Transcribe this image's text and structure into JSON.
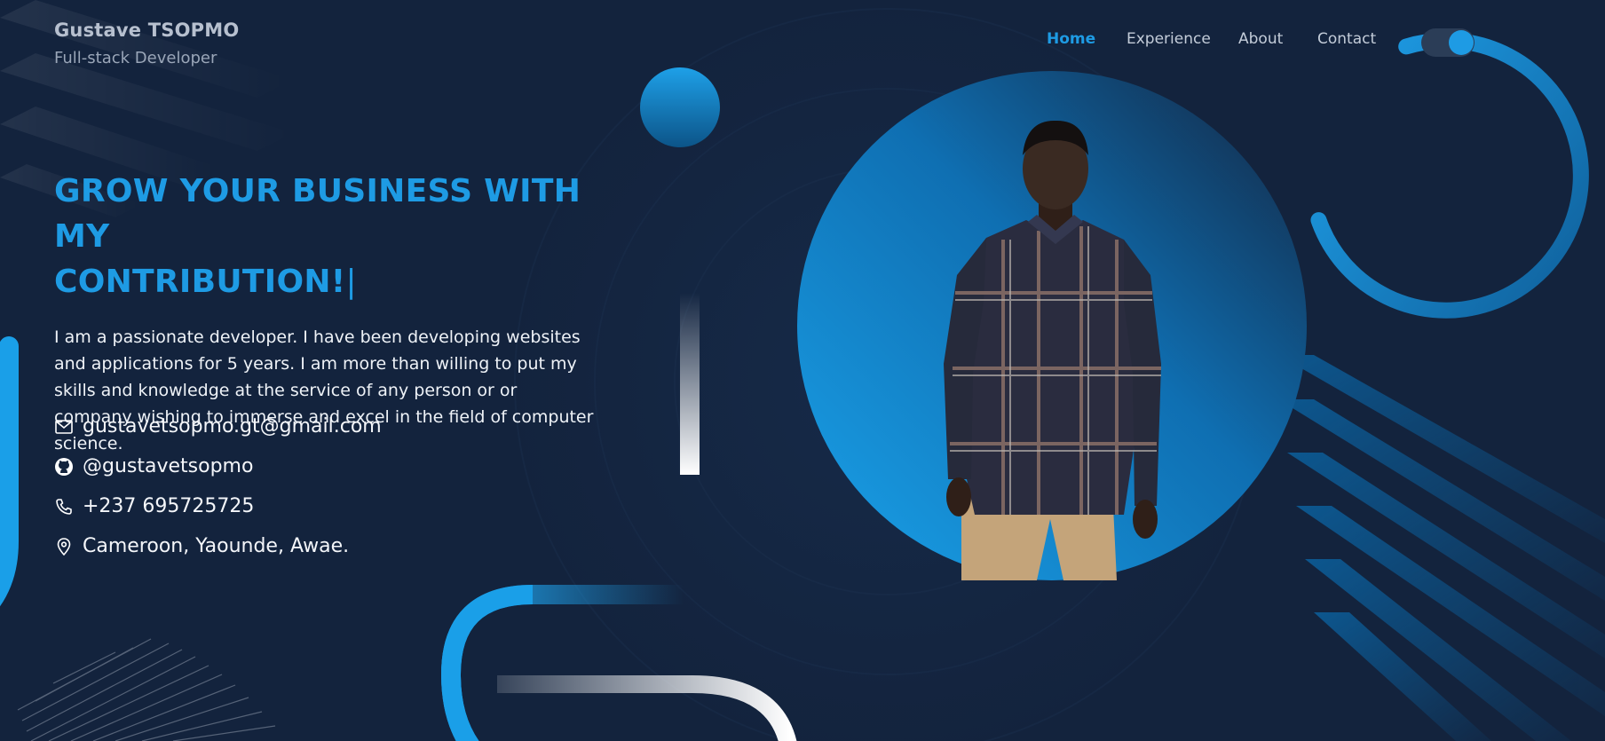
{
  "brand": {
    "name": "Gustave TSOPMO",
    "role": "Full-stack Developer"
  },
  "nav": {
    "items": [
      {
        "label": "Home",
        "active": true
      },
      {
        "label": "Experience",
        "active": false
      },
      {
        "label": "About",
        "active": false
      },
      {
        "label": "Contact",
        "active": false
      }
    ],
    "theme_toggle": {
      "icon": "moon-icon",
      "state": "dark"
    }
  },
  "hero": {
    "headline_line1": "GROW YOUR BUSINESS WITH MY",
    "headline_line2": "CONTRIBUTION!",
    "caret": "|",
    "intro": "I am a passionate developer. I have been developing websites and applications for 5 years. I am more than willing to put my skills and knowledge at the service of any person or or company wishing to immerse and excel in the field of computer science."
  },
  "contacts": [
    {
      "icon": "mail-icon",
      "text": "gustavetsopmo.gt@gmail.com"
    },
    {
      "icon": "github-icon",
      "text": "@gustavetsopmo"
    },
    {
      "icon": "phone-icon",
      "text": "+237 695725725"
    },
    {
      "icon": "location-pin-icon",
      "text": "Cameroon, Yaounde, Awae."
    }
  ],
  "colors": {
    "background": "#13233d",
    "accent": "#1e9be4",
    "text": "#ffffff",
    "muted": "#9aa6b8"
  }
}
